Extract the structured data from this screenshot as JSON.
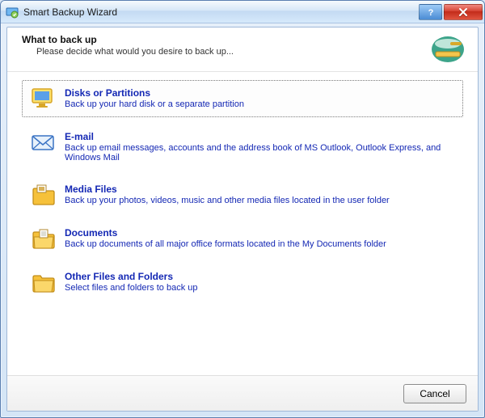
{
  "window": {
    "title": "Smart Backup Wizard",
    "help_tooltip": "?",
    "close_tooltip": "Close"
  },
  "header": {
    "title": "What to back up",
    "subtitle": "Please decide what would you desire to back up..."
  },
  "options": [
    {
      "id": "disks",
      "title": "Disks or Partitions",
      "desc": "Back up your hard disk or a separate partition",
      "selected": true,
      "icon": "monitor-icon"
    },
    {
      "id": "email",
      "title": "E-mail",
      "desc": "Back up email messages, accounts and the address book of MS Outlook, Outlook Express, and Windows Mail",
      "selected": false,
      "icon": "envelope-icon"
    },
    {
      "id": "media",
      "title": "Media Files",
      "desc": "Back up your photos, videos, music and other media files located in the user folder",
      "selected": false,
      "icon": "media-folder-icon"
    },
    {
      "id": "documents",
      "title": "Documents",
      "desc": "Back up documents of all major office formats located in the My Documents folder",
      "selected": false,
      "icon": "documents-folder-icon"
    },
    {
      "id": "other",
      "title": "Other Files and Folders",
      "desc": "Select files and folders to back up",
      "selected": false,
      "icon": "folder-icon"
    }
  ],
  "footer": {
    "cancel": "Cancel"
  },
  "colors": {
    "link": "#1428b4",
    "folder": "#f6c13a",
    "folder_dark": "#d89b1e"
  }
}
